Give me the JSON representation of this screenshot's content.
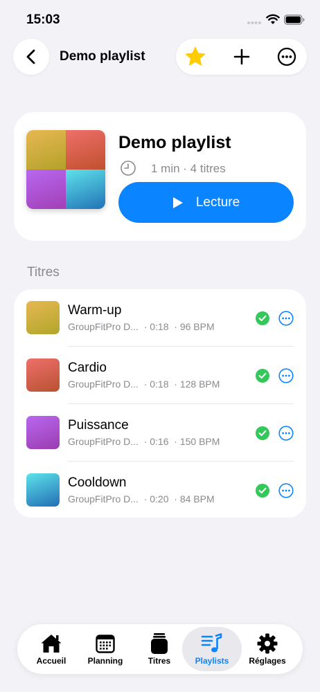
{
  "status_bar": {
    "time": "15:03"
  },
  "nav": {
    "title": "Demo playlist",
    "back_icon": "chevron-left-icon",
    "actions": [
      "star-icon",
      "plus-icon",
      "more-circle-icon"
    ]
  },
  "colors": {
    "accent": "#0a84ff",
    "star": "#ffcc00",
    "check": "#34c759"
  },
  "playlist": {
    "title": "Demo playlist",
    "meta": "1 min · 4 titres",
    "play_label": "Lecture"
  },
  "section": {
    "label": "Titres"
  },
  "tracks": [
    {
      "title": "Warm-up",
      "source": "GroupFitPro D...",
      "duration": "· 0:18",
      "bpm": "· 96 BPM"
    },
    {
      "title": "Cardio",
      "source": "GroupFitPro D...",
      "duration": "· 0:18",
      "bpm": "· 128 BPM"
    },
    {
      "title": "Puissance",
      "source": "GroupFitPro D...",
      "duration": "· 0:16",
      "bpm": "· 150 BPM"
    },
    {
      "title": "Cooldown",
      "source": "GroupFitPro D...",
      "duration": "· 0:20",
      "bpm": "· 84 BPM"
    }
  ],
  "tabs": [
    {
      "label": "Accueil",
      "icon": "house-icon"
    },
    {
      "label": "Planning",
      "icon": "calendar-icon"
    },
    {
      "label": "Titres",
      "icon": "jar-icon"
    },
    {
      "label": "Playlists",
      "icon": "music-list-icon",
      "active": true
    },
    {
      "label": "Réglages",
      "icon": "gear-icon"
    }
  ]
}
